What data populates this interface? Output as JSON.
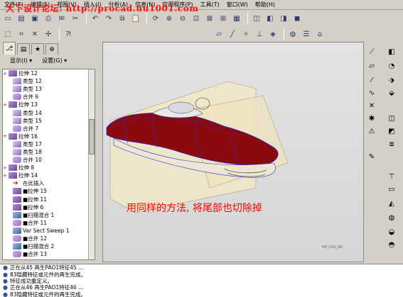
{
  "menubar": {
    "items": [
      "文件(F)",
      "编辑(E)",
      "视图(V)",
      "插入(I)",
      "分析(A)",
      "信息(N)",
      "应用程序(P)",
      "工具(T)",
      "窗口(W)",
      "帮助(H)"
    ],
    "watermark": "大下设计论坛: http://procad.uu1001.com"
  },
  "model_panel": {
    "display_label": "显示(I) ▾",
    "settings_label": "设置(G) ▾"
  },
  "tree": {
    "rows": [
      {
        "label": "拉伸 12",
        "icon": "extrude-icon",
        "expand": "+"
      },
      {
        "label": "类型 12",
        "icon": "pattern-icon",
        "expand": ""
      },
      {
        "label": "类型 13",
        "icon": "pattern-icon",
        "expand": ""
      },
      {
        "label": "合并 6",
        "icon": "merge-icon",
        "expand": ""
      },
      {
        "label": "拉伸 13",
        "icon": "extrude-icon",
        "expand": "+"
      },
      {
        "label": "类型 14",
        "icon": "pattern-icon",
        "expand": ""
      },
      {
        "label": "类型 15",
        "icon": "pattern-icon",
        "expand": ""
      },
      {
        "label": "合并 7",
        "icon": "merge-icon",
        "expand": ""
      },
      {
        "label": "拉伸 16",
        "icon": "extrude-icon",
        "expand": "+"
      },
      {
        "label": "类型 17",
        "icon": "pattern-icon",
        "expand": ""
      },
      {
        "label": "类型 18",
        "icon": "pattern-icon",
        "expand": ""
      },
      {
        "label": "合并 10",
        "icon": "merge-icon",
        "expand": ""
      },
      {
        "label": "拉伸 8",
        "icon": "extrude-icon",
        "expand": "+"
      },
      {
        "label": "拉伸 14",
        "icon": "extrude-icon",
        "expand": "+"
      },
      {
        "label": "在此插入",
        "icon": "insert-arrow-icon",
        "expand": ""
      },
      {
        "label": "■拉伸 15",
        "icon": "extrude-icon",
        "expand": ""
      },
      {
        "label": "■拉伸 11",
        "icon": "extrude-icon",
        "expand": ""
      },
      {
        "label": "■拉伸 6",
        "icon": "extrude-icon",
        "expand": ""
      },
      {
        "label": "■扫描混合 1",
        "icon": "sweep-blend-icon",
        "expand": ""
      },
      {
        "label": "■合并 11",
        "icon": "merge-icon",
        "expand": ""
      },
      {
        "label": "Var Sect Sweep 1",
        "icon": "sweep-icon",
        "expand": ""
      },
      {
        "label": "■合并 12",
        "icon": "merge-icon",
        "expand": ""
      },
      {
        "label": "■扫描混合 2",
        "icon": "sweep-blend-icon",
        "expand": ""
      },
      {
        "label": "■合并 13",
        "icon": "merge-icon",
        "expand": ""
      }
    ]
  },
  "viewport": {
    "caption": "用同样的方法, 将尾部也切除掉",
    "corner_label": "PRT_CSYS_DEF",
    "colors": {
      "body": "#8b0a0e",
      "plane": "#f2e8c8",
      "edge": "#2a2ad0"
    }
  },
  "messages": [
    "正在从45 再生PAO1特征45 ...",
    "83隐藏特征或元件的再生完成。",
    "特征成功重定义。",
    "正在从46 再生PAO1特征46 ...",
    "83隐藏特征或元件的再生完成。"
  ]
}
